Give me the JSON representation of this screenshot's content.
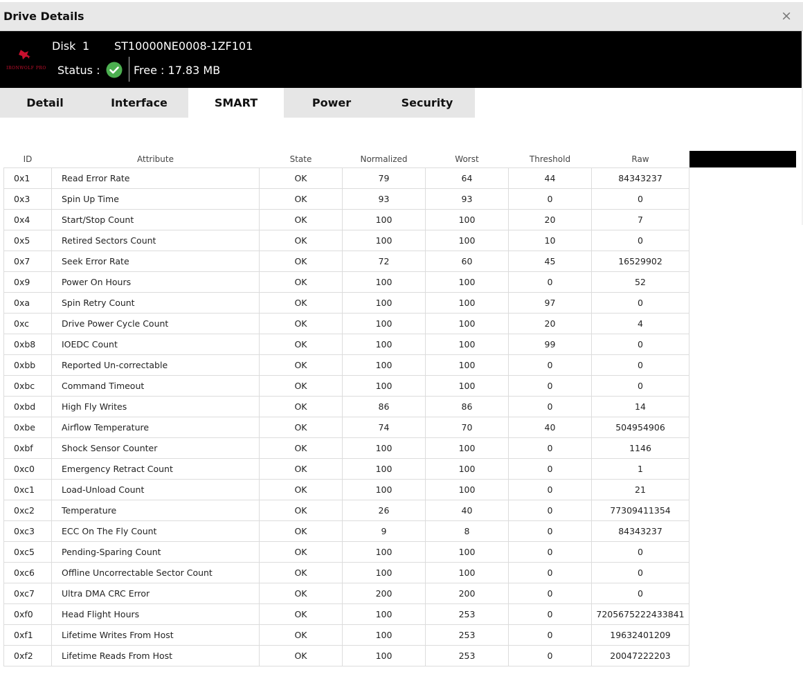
{
  "window": {
    "title": "Drive Details",
    "close_glyph": "×"
  },
  "drive": {
    "disk_label": "Disk",
    "disk_number": "1",
    "model": "ST10000NE0008-1ZF101",
    "status_label": "Status :",
    "status_icon": "check-circle-icon",
    "free_text": "Free : 17.83 MB",
    "logo_text": "IRONWOLF PRO"
  },
  "colors": {
    "status_ok": "#4caf50",
    "logo_red": "#c8102e",
    "header_bg": "#000000"
  },
  "tabs": [
    {
      "label": "Detail",
      "active": false
    },
    {
      "label": "Interface",
      "active": false
    },
    {
      "label": "SMART",
      "active": true
    },
    {
      "label": "Power",
      "active": false
    },
    {
      "label": "Security",
      "active": false
    }
  ],
  "table": {
    "headers": [
      "ID",
      "Attribute",
      "State",
      "Normalized",
      "Worst",
      "Threshold",
      "Raw"
    ],
    "rows": [
      [
        "0x1",
        "Read Error Rate",
        "OK",
        "79",
        "64",
        "44",
        "84343237"
      ],
      [
        "0x3",
        "Spin Up Time",
        "OK",
        "93",
        "93",
        "0",
        "0"
      ],
      [
        "0x4",
        "Start/Stop Count",
        "OK",
        "100",
        "100",
        "20",
        "7"
      ],
      [
        "0x5",
        "Retired Sectors Count",
        "OK",
        "100",
        "100",
        "10",
        "0"
      ],
      [
        "0x7",
        "Seek Error Rate",
        "OK",
        "72",
        "60",
        "45",
        "16529902"
      ],
      [
        "0x9",
        "Power On Hours",
        "OK",
        "100",
        "100",
        "0",
        "52"
      ],
      [
        "0xa",
        "Spin Retry Count",
        "OK",
        "100",
        "100",
        "97",
        "0"
      ],
      [
        "0xc",
        "Drive Power Cycle Count",
        "OK",
        "100",
        "100",
        "20",
        "4"
      ],
      [
        "0xb8",
        "IOEDC Count",
        "OK",
        "100",
        "100",
        "99",
        "0"
      ],
      [
        "0xbb",
        "Reported Un-correctable",
        "OK",
        "100",
        "100",
        "0",
        "0"
      ],
      [
        "0xbc",
        "Command Timeout",
        "OK",
        "100",
        "100",
        "0",
        "0"
      ],
      [
        "0xbd",
        "High Fly Writes",
        "OK",
        "86",
        "86",
        "0",
        "14"
      ],
      [
        "0xbe",
        "Airflow Temperature",
        "OK",
        "74",
        "70",
        "40",
        "504954906"
      ],
      [
        "0xbf",
        "Shock Sensor Counter",
        "OK",
        "100",
        "100",
        "0",
        "1146"
      ],
      [
        "0xc0",
        "Emergency Retract Count",
        "OK",
        "100",
        "100",
        "0",
        "1"
      ],
      [
        "0xc1",
        "Load-Unload Count",
        "OK",
        "100",
        "100",
        "0",
        "21"
      ],
      [
        "0xc2",
        "Temperature",
        "OK",
        "26",
        "40",
        "0",
        "77309411354"
      ],
      [
        "0xc3",
        "ECC On The Fly Count",
        "OK",
        "9",
        "8",
        "0",
        "84343237"
      ],
      [
        "0xc5",
        "Pending-Sparing Count",
        "OK",
        "100",
        "100",
        "0",
        "0"
      ],
      [
        "0xc6",
        "Offline Uncorrectable Sector Count",
        "OK",
        "100",
        "100",
        "0",
        "0"
      ],
      [
        "0xc7",
        "Ultra DMA CRC Error",
        "OK",
        "200",
        "200",
        "0",
        "0"
      ],
      [
        "0xf0",
        "Head Flight Hours",
        "OK",
        "100",
        "253",
        "0",
        "7205675222433841"
      ],
      [
        "0xf1",
        "Lifetime Writes From Host",
        "OK",
        "100",
        "253",
        "0",
        "19632401209"
      ],
      [
        "0xf2",
        "Lifetime Reads From Host",
        "OK",
        "100",
        "253",
        "0",
        "20047222203"
      ]
    ]
  }
}
